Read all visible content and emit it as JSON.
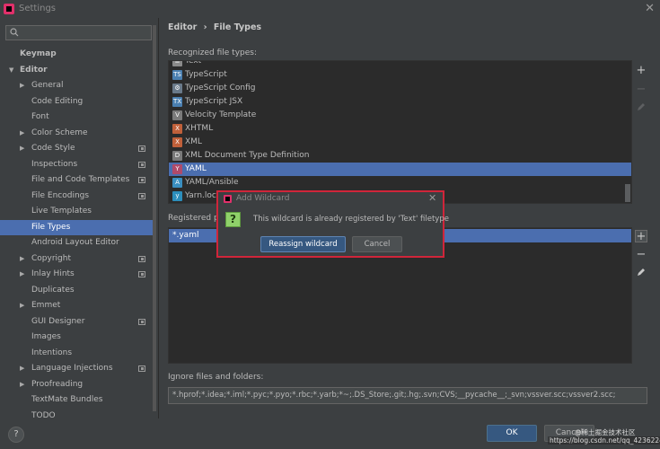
{
  "window": {
    "title": "Settings"
  },
  "search": {
    "value": ""
  },
  "sidebar": {
    "items": [
      {
        "label": "Keymap",
        "indent": 0,
        "arrow": "",
        "bold": true,
        "selected": false,
        "badge": false
      },
      {
        "label": "Editor",
        "indent": 0,
        "arrow": "▼",
        "bold": true,
        "selected": false,
        "badge": false
      },
      {
        "label": "General",
        "indent": 1,
        "arrow": "▶",
        "bold": false,
        "selected": false,
        "badge": false
      },
      {
        "label": "Code Editing",
        "indent": 1,
        "arrow": "",
        "bold": false,
        "selected": false,
        "badge": false
      },
      {
        "label": "Font",
        "indent": 1,
        "arrow": "",
        "bold": false,
        "selected": false,
        "badge": false
      },
      {
        "label": "Color Scheme",
        "indent": 1,
        "arrow": "▶",
        "bold": false,
        "selected": false,
        "badge": false
      },
      {
        "label": "Code Style",
        "indent": 1,
        "arrow": "▶",
        "bold": false,
        "selected": false,
        "badge": true
      },
      {
        "label": "Inspections",
        "indent": 1,
        "arrow": "",
        "bold": false,
        "selected": false,
        "badge": true
      },
      {
        "label": "File and Code Templates",
        "indent": 1,
        "arrow": "",
        "bold": false,
        "selected": false,
        "badge": true
      },
      {
        "label": "File Encodings",
        "indent": 1,
        "arrow": "",
        "bold": false,
        "selected": false,
        "badge": true
      },
      {
        "label": "Live Templates",
        "indent": 1,
        "arrow": "",
        "bold": false,
        "selected": false,
        "badge": false
      },
      {
        "label": "File Types",
        "indent": 1,
        "arrow": "",
        "bold": false,
        "selected": true,
        "badge": false
      },
      {
        "label": "Android Layout Editor",
        "indent": 1,
        "arrow": "",
        "bold": false,
        "selected": false,
        "badge": false
      },
      {
        "label": "Copyright",
        "indent": 1,
        "arrow": "▶",
        "bold": false,
        "selected": false,
        "badge": true
      },
      {
        "label": "Inlay Hints",
        "indent": 1,
        "arrow": "▶",
        "bold": false,
        "selected": false,
        "badge": true
      },
      {
        "label": "Duplicates",
        "indent": 1,
        "arrow": "",
        "bold": false,
        "selected": false,
        "badge": false
      },
      {
        "label": "Emmet",
        "indent": 1,
        "arrow": "▶",
        "bold": false,
        "selected": false,
        "badge": false
      },
      {
        "label": "GUI Designer",
        "indent": 1,
        "arrow": "",
        "bold": false,
        "selected": false,
        "badge": true
      },
      {
        "label": "Images",
        "indent": 1,
        "arrow": "",
        "bold": false,
        "selected": false,
        "badge": false
      },
      {
        "label": "Intentions",
        "indent": 1,
        "arrow": "",
        "bold": false,
        "selected": false,
        "badge": false
      },
      {
        "label": "Language Injections",
        "indent": 1,
        "arrow": "▶",
        "bold": false,
        "selected": false,
        "badge": true
      },
      {
        "label": "Proofreading",
        "indent": 1,
        "arrow": "▶",
        "bold": false,
        "selected": false,
        "badge": false
      },
      {
        "label": "TextMate Bundles",
        "indent": 1,
        "arrow": "",
        "bold": false,
        "selected": false,
        "badge": false
      },
      {
        "label": "TODO",
        "indent": 1,
        "arrow": "",
        "bold": false,
        "selected": false,
        "badge": false
      }
    ]
  },
  "breadcrumb": {
    "parent": "Editor",
    "separator": "›",
    "current": "File Types"
  },
  "recognized": {
    "label": "Recognized file types:",
    "items": [
      {
        "label": "Text",
        "icon": "text-file-icon",
        "color": "#8a8a8a",
        "glyph": "≡",
        "selected": false
      },
      {
        "label": "TypeScript",
        "icon": "typescript-file-icon",
        "color": "#4a7fb0",
        "glyph": "TS",
        "selected": false
      },
      {
        "label": "TypeScript Config",
        "icon": "typescript-config-icon",
        "color": "#6a7a8a",
        "glyph": "⚙",
        "selected": false
      },
      {
        "label": "TypeScript JSX",
        "icon": "typescript-jsx-icon",
        "color": "#4a7fb0",
        "glyph": "TX",
        "selected": false
      },
      {
        "label": "Velocity Template",
        "icon": "velocity-template-icon",
        "color": "#7a7a7a",
        "glyph": "V",
        "selected": false
      },
      {
        "label": "XHTML",
        "icon": "xhtml-file-icon",
        "color": "#c0603a",
        "glyph": "X",
        "selected": false
      },
      {
        "label": "XML",
        "icon": "xml-file-icon",
        "color": "#c0603a",
        "glyph": "X",
        "selected": false
      },
      {
        "label": "XML Document Type Definition",
        "icon": "dtd-file-icon",
        "color": "#7a7a7a",
        "glyph": "D",
        "selected": false
      },
      {
        "label": "YAML",
        "icon": "yaml-file-icon",
        "color": "#b04a6a",
        "glyph": "Y",
        "selected": true
      },
      {
        "label": "YAML/Ansible",
        "icon": "ansible-icon",
        "color": "#3a8fc0",
        "glyph": "A",
        "selected": false
      },
      {
        "label": "Yarn.lock",
        "icon": "yarn-lock-icon",
        "color": "#2c8ebb",
        "glyph": "y",
        "selected": false
      }
    ]
  },
  "registered": {
    "label": "Registered pa",
    "items": [
      "*.yaml"
    ]
  },
  "ignore": {
    "label": "Ignore files and folders:",
    "value": "*.hprof;*.idea;*.iml;*.pyc;*.pyo;*.rbc;*.yarb;*~;.DS_Store;.git;.hg;.svn;CVS;__pycache__;_svn;vssver.scc;vssver2.scc;"
  },
  "buttons": {
    "ok": "OK",
    "cancel": "Cancel",
    "help": "?"
  },
  "dialog": {
    "title": "Add Wildcard",
    "message": "This wildcard is already registered by 'Text' filetype",
    "question_glyph": "?",
    "reassign": "Reassign wildcard",
    "cancel": "Cancel"
  },
  "watermark": {
    "line1": "@稀土掘金技术社区",
    "line2": "https://blog.csdn.net/qq_42362240"
  },
  "colors": {
    "accent": "#4b6eaf",
    "dialog_border": "#d0253a",
    "primary_button": "#365880"
  }
}
